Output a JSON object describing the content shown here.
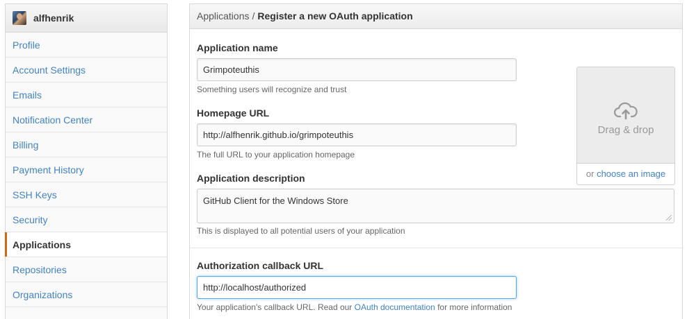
{
  "sidebar": {
    "username": "alfhenrik",
    "items": [
      {
        "label": "Profile"
      },
      {
        "label": "Account Settings"
      },
      {
        "label": "Emails"
      },
      {
        "label": "Notification Center"
      },
      {
        "label": "Billing"
      },
      {
        "label": "Payment History"
      },
      {
        "label": "SSH Keys"
      },
      {
        "label": "Security"
      },
      {
        "label": "Applications",
        "active": true
      },
      {
        "label": "Repositories"
      },
      {
        "label": "Organizations"
      }
    ]
  },
  "header": {
    "breadcrumb_parent": "Applications",
    "breadcrumb_separator": "/",
    "title": "Register a new OAuth application"
  },
  "form": {
    "app_name": {
      "label": "Application name",
      "value": "Grimpoteuthis",
      "hint": "Something users will recognize and trust"
    },
    "homepage": {
      "label": "Homepage URL",
      "value": "http://alfhenrik.github.io/grimpoteuthis",
      "hint": "The full URL to your application homepage"
    },
    "description": {
      "label": "Application description",
      "value": "GitHub Client for the Windows Store",
      "hint": "This is displayed to all potential users of your application"
    },
    "callback": {
      "label": "Authorization callback URL",
      "value": "http://localhost/authorized",
      "hint_before": "Your application's callback URL. Read our",
      "hint_link": "OAuth documentation",
      "hint_after": "for more information"
    }
  },
  "upload": {
    "drop_text": "Drag & drop",
    "or_text": "or",
    "choose_link": "choose an image",
    "icon": "cloud-upload-icon"
  },
  "colors": {
    "link": "#4183c4",
    "active_marker": "#d26911",
    "focus_border": "#51a7e8"
  }
}
